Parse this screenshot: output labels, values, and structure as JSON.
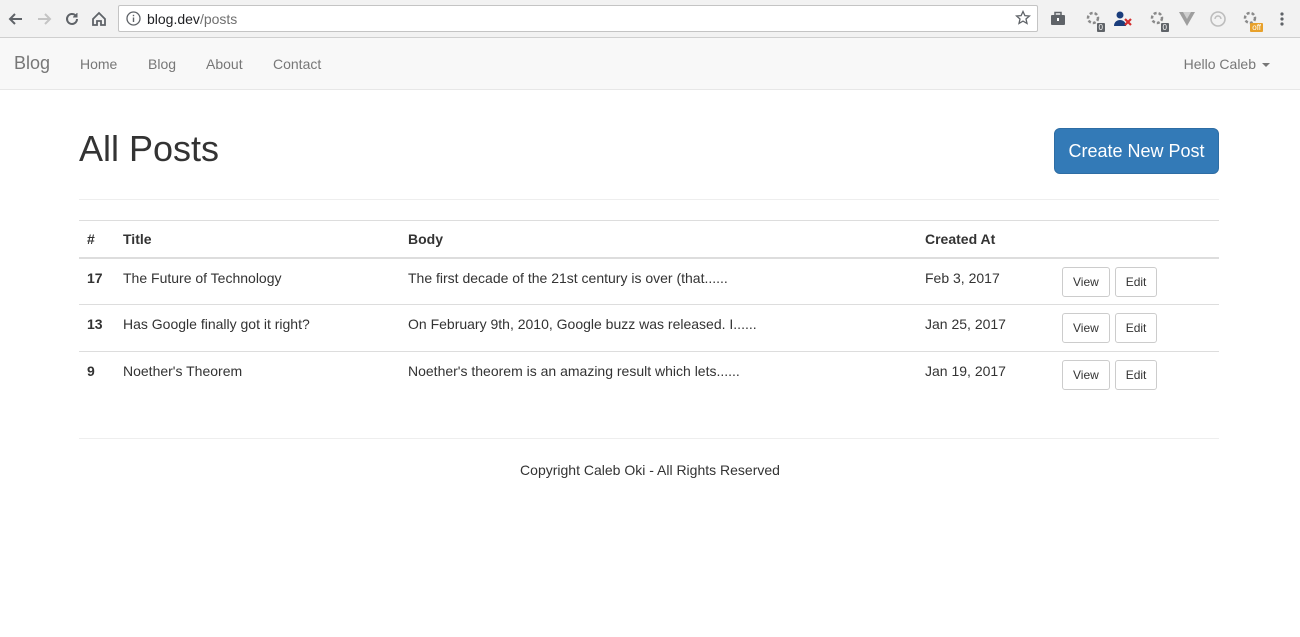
{
  "browser": {
    "url_host": "blog.dev",
    "url_path": "/posts",
    "extensions": [
      {
        "name": "briefcase-extension-icon",
        "badge": ""
      },
      {
        "name": "gear-extension-icon",
        "badge": "0"
      },
      {
        "name": "person-blocked-extension-icon",
        "badge": ""
      },
      {
        "name": "gear-extension-2-icon",
        "badge": "0"
      },
      {
        "name": "vuejs-extension-icon",
        "badge": ""
      },
      {
        "name": "circle-extension-icon",
        "badge": ""
      },
      {
        "name": "gear-extension-3-icon",
        "badge": "off"
      }
    ]
  },
  "navbar": {
    "brand": "Blog",
    "links": [
      "Home",
      "Blog",
      "About",
      "Contact"
    ],
    "user": "Hello Caleb"
  },
  "page": {
    "title": "All Posts",
    "create_button": "Create New Post"
  },
  "table": {
    "headers": [
      "#",
      "Title",
      "Body",
      "Created At"
    ],
    "rows": [
      {
        "id": "17",
        "title": "The Future of Technology",
        "body": "The first decade of the 21st century is over (that......",
        "created": "Feb 3, 2017",
        "view": "View",
        "edit": "Edit"
      },
      {
        "id": "13",
        "title": "Has Google finally got it right?",
        "body": "On February 9th, 2010, Google buzz was released. I......",
        "created": "Jan 25, 2017",
        "view": "View",
        "edit": "Edit"
      },
      {
        "id": "9",
        "title": "Noether's Theorem",
        "body": "Noether's theorem is an amazing result which lets......",
        "created": "Jan 19, 2017",
        "view": "View",
        "edit": "Edit"
      }
    ]
  },
  "footer": {
    "text": "Copyright Caleb Oki - All Rights Reserved"
  },
  "colors": {
    "primary": "#337ab7",
    "navbar_bg": "#f8f8f8",
    "text": "#333333",
    "muted": "#777777"
  }
}
